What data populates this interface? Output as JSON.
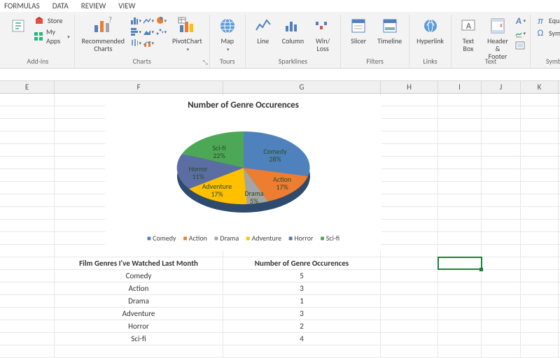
{
  "tabs": {
    "formulas": "FORMULAS",
    "data": "DATA",
    "review": "REVIEW",
    "view": "VIEW"
  },
  "ribbon": {
    "addins": {
      "store": "Store",
      "myapps": "My Apps",
      "label": "Add-ins"
    },
    "charts": {
      "recommended": "Recommended\nCharts",
      "pivot": "PivotChart",
      "label": "Charts"
    },
    "tours": {
      "map": "Map",
      "label": "Tours"
    },
    "sparklines": {
      "line": "Line",
      "column": "Column",
      "winloss": "Win/\nLoss",
      "label": "Sparklines"
    },
    "filters": {
      "slicer": "Slicer",
      "timeline": "Timeline",
      "label": "Filters"
    },
    "links": {
      "hyperlink": "Hyperlink",
      "label": "Links"
    },
    "text": {
      "textbox": "Text\nBox",
      "headerfooter": "Header\n& Footer",
      "label": "Text"
    },
    "symbols": {
      "equation": "Equation",
      "symbol": "Symbol",
      "label": "Symbols"
    }
  },
  "columns": {
    "E": "E",
    "F": "F",
    "G": "G",
    "H": "H",
    "I": "I",
    "J": "J",
    "K": "K"
  },
  "chart_data": {
    "type": "pie",
    "title": "Number of Genre Occurences",
    "categories": [
      "Comedy",
      "Action",
      "Drama",
      "Adventure",
      "Horror",
      "Sci-fi"
    ],
    "values": [
      5,
      3,
      1,
      3,
      2,
      4
    ],
    "percentages": [
      28,
      17,
      5,
      17,
      11,
      22
    ],
    "colors": [
      "#4f81bd",
      "#ed7d31",
      "#a5a5a5",
      "#ffc000",
      "#5b6ea4",
      "#4ca856"
    ],
    "data_labels": [
      "Comedy\n28%",
      "Action\n17%",
      "Drama\n5%",
      "Adventure\n17%",
      "Horror\n11%",
      "Sci-fi\n22%"
    ],
    "legend_position": "bottom"
  },
  "table": {
    "header_f": "Film Genres I've Watched Last Month",
    "header_g": "Number of Genre Occurences",
    "rows": [
      {
        "genre": "Comedy",
        "count": "5"
      },
      {
        "genre": "Action",
        "count": "3"
      },
      {
        "genre": "Drama",
        "count": "1"
      },
      {
        "genre": "Adventure",
        "count": "3"
      },
      {
        "genre": "Horror",
        "count": "2"
      },
      {
        "genre": "Sci-fi",
        "count": "4"
      }
    ]
  }
}
